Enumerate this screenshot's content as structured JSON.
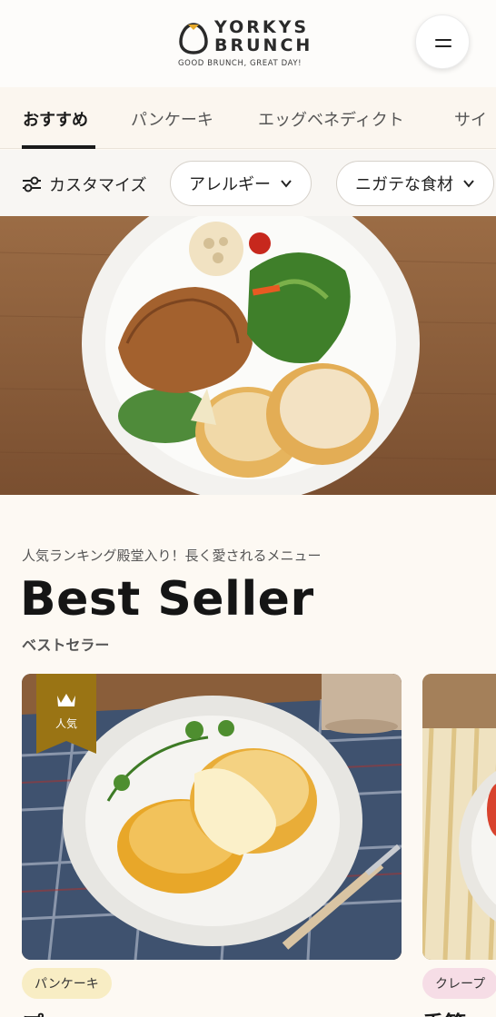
{
  "header": {
    "logo_line1": "YORKYS",
    "logo_line2": "BRUNCH",
    "tagline": "GOOD BRUNCH, GREAT DAY!"
  },
  "tabs": [
    {
      "label": "おすすめ",
      "active": true
    },
    {
      "label": "パンケーキ",
      "active": false
    },
    {
      "label": "エッグベネディクト",
      "active": false
    },
    {
      "label": "サイ",
      "active": false
    }
  ],
  "filters": {
    "customize_label": "カスタマイズ",
    "pills": [
      {
        "label": "アレルギー"
      },
      {
        "label": "ニガテな食材"
      }
    ]
  },
  "section": {
    "subtitle": "人気ランキング殿堂入り！長く愛されるメニュー",
    "title": "Best Seller",
    "title_ja": "ベストセラー"
  },
  "cards": [
    {
      "ribbon": "人気",
      "tag": "パンケーキ",
      "name_peek": "プ"
    },
    {
      "tag": "クレープ",
      "name_peek": "季節"
    }
  ],
  "colors": {
    "ribbon": "#9a7414",
    "tag_pancake": "#f8edc4",
    "tag_crepe": "#f6dde6",
    "active_tab": "#1a1a1a"
  }
}
